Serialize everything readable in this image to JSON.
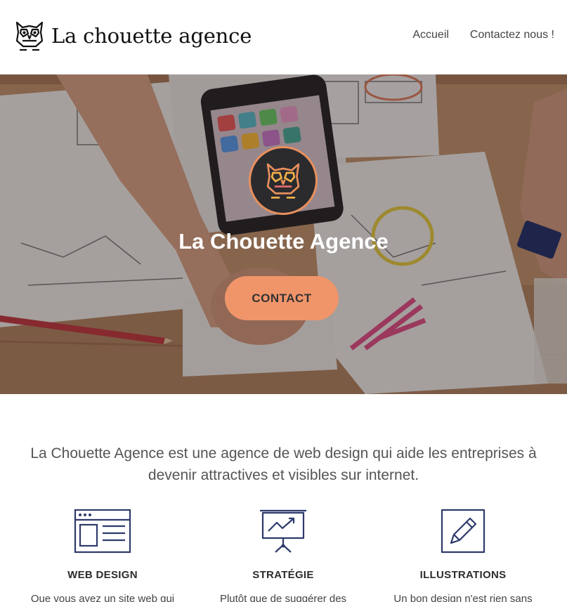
{
  "header": {
    "brand": "La chouette agence",
    "nav": [
      {
        "label": "Accueil"
      },
      {
        "label": "Contactez nous !"
      }
    ]
  },
  "hero": {
    "title": "La Chouette Agence",
    "cta_label": "CONTACT"
  },
  "intro": {
    "text": "La Chouette Agence est une agence de web design qui aide les entreprises à devenir attractives et visibles sur internet."
  },
  "features": [
    {
      "icon": "browser-window-icon",
      "title": "WEB DESIGN",
      "desc": "Que vous ayez un site web qui"
    },
    {
      "icon": "presentation-board-icon",
      "title": "STRATÉGIE",
      "desc": "Plutôt que de suggérer des"
    },
    {
      "icon": "pencil-icon",
      "title": "ILLUSTRATIONS",
      "desc": "Un bon design n'est rien sans"
    }
  ],
  "colors": {
    "accent": "#f0956a",
    "icon_navy": "#2e3a6b",
    "hero_overlay": "#281e1e"
  }
}
